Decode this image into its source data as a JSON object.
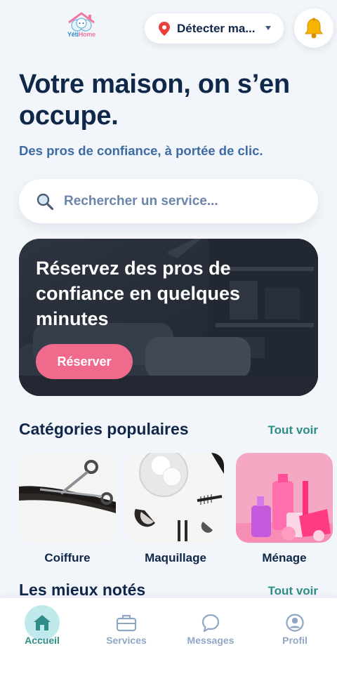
{
  "header": {
    "logo_text_main": "Yéti",
    "logo_text_accent": "Home",
    "location_label": "Détecter ma...",
    "location_icon": "pin-icon",
    "dropdown_icon": "caret-down-icon",
    "notification_icon": "bell-icon"
  },
  "hero": {
    "title": "Votre maison, on s’en occupe.",
    "subtitle": "Des pros de confiance, à portée de clic."
  },
  "search": {
    "placeholder": "Rechercher un service..."
  },
  "banner": {
    "text": "Réservez des pros de confiance en quelques minutes",
    "button_label": "Réserver"
  },
  "categories": {
    "title": "Catégories populaires",
    "see_all": "Tout voir",
    "items": [
      {
        "label": "Coiffure"
      },
      {
        "label": "Maquillage"
      },
      {
        "label": "Ménage"
      }
    ]
  },
  "top_rated": {
    "title": "Les mieux notés",
    "see_all": "Tout voir"
  },
  "nav": {
    "items": [
      {
        "label": "Accueil",
        "icon": "home-icon",
        "active": true
      },
      {
        "label": "Services",
        "icon": "briefcase-icon",
        "active": false
      },
      {
        "label": "Messages",
        "icon": "chat-icon",
        "active": false
      },
      {
        "label": "Profil",
        "icon": "profile-icon",
        "active": false
      }
    ]
  },
  "colors": {
    "primary_dark": "#0f2749",
    "accent_teal": "#2e8d86",
    "accent_pink": "#f06a8b",
    "subtitle_blue": "#3c6ba6"
  }
}
